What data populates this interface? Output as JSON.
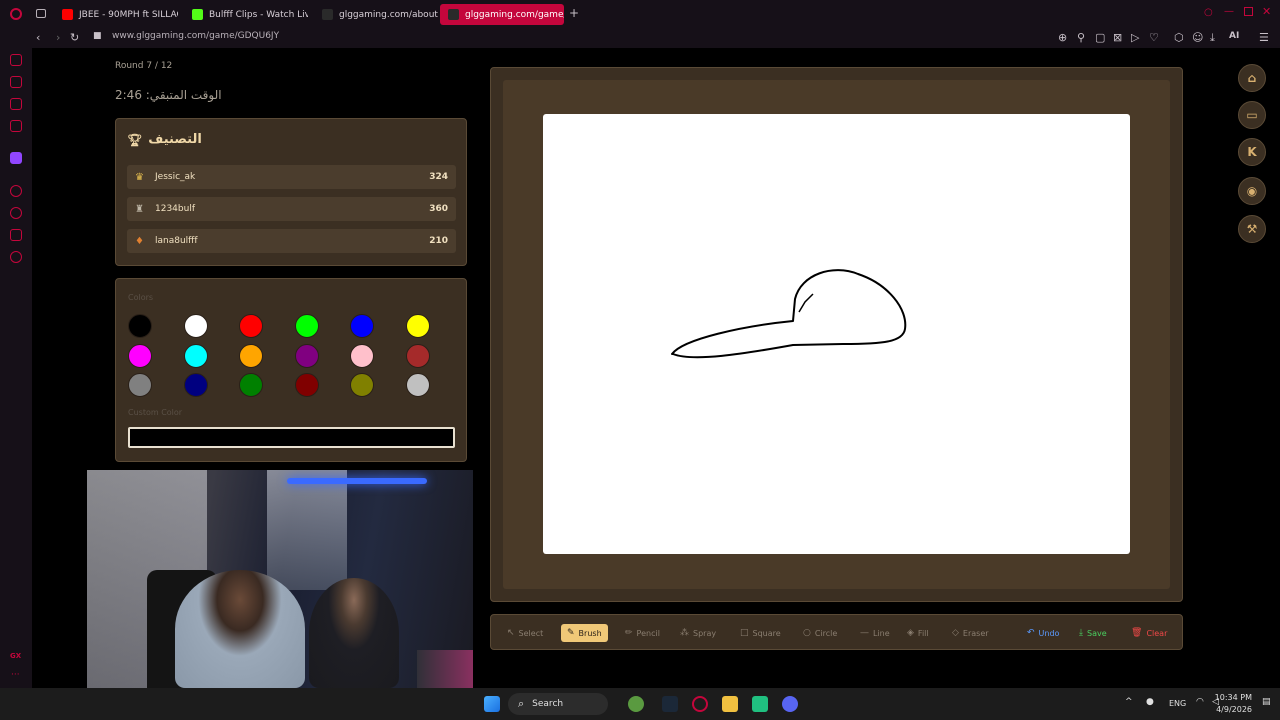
{
  "browser": {
    "tabs": [
      {
        "label": "JBEE - 90MPH ft SILLAGE",
        "color": "#ff0000"
      },
      {
        "label": "Bulfff Clips - Watch Live c",
        "color": "#53fc18"
      },
      {
        "label": "glggaming.com/about-us",
        "color": "#2a2a2a"
      },
      {
        "label": "glggaming.com/game/GDQ",
        "color": "#2a2a2a"
      }
    ],
    "url": "www.glggaming.com/game/GDQU6JY",
    "ai_label": "AI"
  },
  "game": {
    "round": "Round 7 / 12",
    "timer": "الوقت المتبقي: 2:46"
  },
  "leaderboard": {
    "title": "التصنيف",
    "players": [
      {
        "name": "Jessic_ak",
        "score": "324",
        "icon": "crown-icon"
      },
      {
        "name": "1234bulf",
        "score": "360",
        "icon": "trophy-icon"
      },
      {
        "name": "lana8ulfff",
        "score": "210",
        "icon": "medal-icon"
      }
    ]
  },
  "colors": {
    "label": "Colors",
    "swatches": [
      "#000000",
      "#ffffff",
      "#ff0000",
      "#00ff00",
      "#0000ff",
      "#ffff00",
      "#ff00ff",
      "#00ffff",
      "#ffa500",
      "#800080",
      "#ffc0cb",
      "#a52a2a",
      "#808080",
      "#000080",
      "#008000",
      "#800000",
      "#808000",
      "#c0c0c0"
    ],
    "custom_label": "Custom Color"
  },
  "toolbar": {
    "tools": [
      {
        "label": "Select",
        "icon": "cursor-icon"
      },
      {
        "label": "Brush",
        "icon": "brush-icon",
        "active": true
      },
      {
        "label": "Pencil",
        "icon": "pencil-icon"
      },
      {
        "label": "Spray",
        "icon": "spray-icon"
      },
      {
        "label": "Square",
        "icon": "square-icon"
      },
      {
        "label": "Circle",
        "icon": "circle-icon"
      },
      {
        "label": "Line",
        "icon": "line-icon"
      },
      {
        "label": "Fill",
        "icon": "fill-icon"
      },
      {
        "label": "Eraser",
        "icon": "eraser-icon"
      }
    ],
    "undo": "Undo",
    "save": "Save",
    "clear": "Clear"
  },
  "taskbar": {
    "search": "Search",
    "lang": "ENG",
    "time": "10:34 PM",
    "date": "4/9/2026"
  }
}
